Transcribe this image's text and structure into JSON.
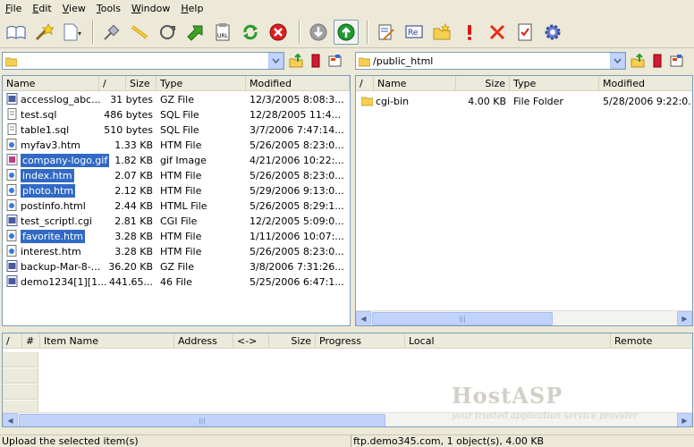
{
  "menu": [
    "File",
    "Edit",
    "View",
    "Tools",
    "Window",
    "Help"
  ],
  "toolbar": {
    "icons": [
      "open-book-icon",
      "magic-wand-icon",
      "new-document-icon",
      "connect-plug-icon",
      "disconnect-icon",
      "reconnect-icon",
      "go-to-folder-icon",
      "url-clipboard-icon",
      "refresh-icon",
      "stop-icon",
      "download-icon",
      "upload-icon",
      "edit-file-icon",
      "rename-icon",
      "new-folder-icon",
      "exclamation-icon",
      "delete-icon",
      "properties-icon",
      "settings-gear-icon"
    ]
  },
  "left_pane": {
    "path": "",
    "columns": [
      "Name",
      "/",
      "Size",
      "Type",
      "Modified"
    ],
    "files": [
      {
        "name": "accesslog_abc...",
        "size": "31 bytes",
        "type": "GZ File",
        "modified": "12/3/2005 8:08:3...",
        "selected": false,
        "icon": "gz"
      },
      {
        "name": "test.sql",
        "size": "486 bytes",
        "type": "SQL File",
        "modified": "12/28/2005 11:4...",
        "selected": false,
        "icon": "doc"
      },
      {
        "name": "table1.sql",
        "size": "510 bytes",
        "type": "SQL File",
        "modified": "3/7/2006 7:47:14...",
        "selected": false,
        "icon": "doc"
      },
      {
        "name": "myfav3.htm",
        "size": "1.33 KB",
        "type": "HTM File",
        "modified": "5/26/2005 8:23:0...",
        "selected": false,
        "icon": "htm"
      },
      {
        "name": "company-logo.gif",
        "size": "1.82 KB",
        "type": "gif Image",
        "modified": "4/21/2006 10:22:...",
        "selected": true,
        "icon": "img"
      },
      {
        "name": "index.htm",
        "size": "2.07 KB",
        "type": "HTM File",
        "modified": "5/26/2005 8:23:0...",
        "selected": true,
        "icon": "htm"
      },
      {
        "name": "photo.htm",
        "size": "2.12 KB",
        "type": "HTM File",
        "modified": "5/29/2006 9:13:0...",
        "selected": true,
        "icon": "htm"
      },
      {
        "name": "postinfo.html",
        "size": "2.44 KB",
        "type": "HTML File",
        "modified": "5/26/2005 8:29:1...",
        "selected": false,
        "icon": "htm"
      },
      {
        "name": "test_scriptl.cgi",
        "size": "2.81 KB",
        "type": "CGI File",
        "modified": "12/2/2005 5:09:0...",
        "selected": false,
        "icon": "gz"
      },
      {
        "name": "favorite.htm",
        "size": "3.28 KB",
        "type": "HTM File",
        "modified": "1/11/2006 10:07:...",
        "selected": true,
        "icon": "htm"
      },
      {
        "name": "interest.htm",
        "size": "3.28 KB",
        "type": "HTM File",
        "modified": "5/26/2005 8:23:0...",
        "selected": false,
        "icon": "htm"
      },
      {
        "name": "backup-Mar-8-...",
        "size": "36.20 KB",
        "type": "GZ File",
        "modified": "3/8/2006 7:31:26...",
        "selected": false,
        "icon": "gz"
      },
      {
        "name": "demo1234[1][1...",
        "size": "441.65...",
        "type": "46 File",
        "modified": "5/25/2006 6:47:1...",
        "selected": false,
        "icon": "gz"
      }
    ]
  },
  "right_pane": {
    "path": "/public_html",
    "columns": [
      "/",
      "Name",
      "Size",
      "Type",
      "Modified"
    ],
    "files": [
      {
        "name": "cgi-bin",
        "size": "4.00 KB",
        "type": "File Folder",
        "modified": "5/28/2006 9:22:0..."
      }
    ]
  },
  "queue": {
    "columns": [
      "/",
      "#",
      "Item Name",
      "Address",
      "<->",
      "Size",
      "Progress",
      "Local",
      "Remote"
    ]
  },
  "watermark": {
    "brand": "HostASP",
    "tagline": "your trusted application service provider"
  },
  "status": {
    "left": "Upload the selected item(s)",
    "right": "ftp.demo345.com, 1 object(s), 4.00 KB"
  },
  "colors": {
    "selection": "#316ac5",
    "chrome": "#ece9d8",
    "border": "#7f9db9"
  }
}
